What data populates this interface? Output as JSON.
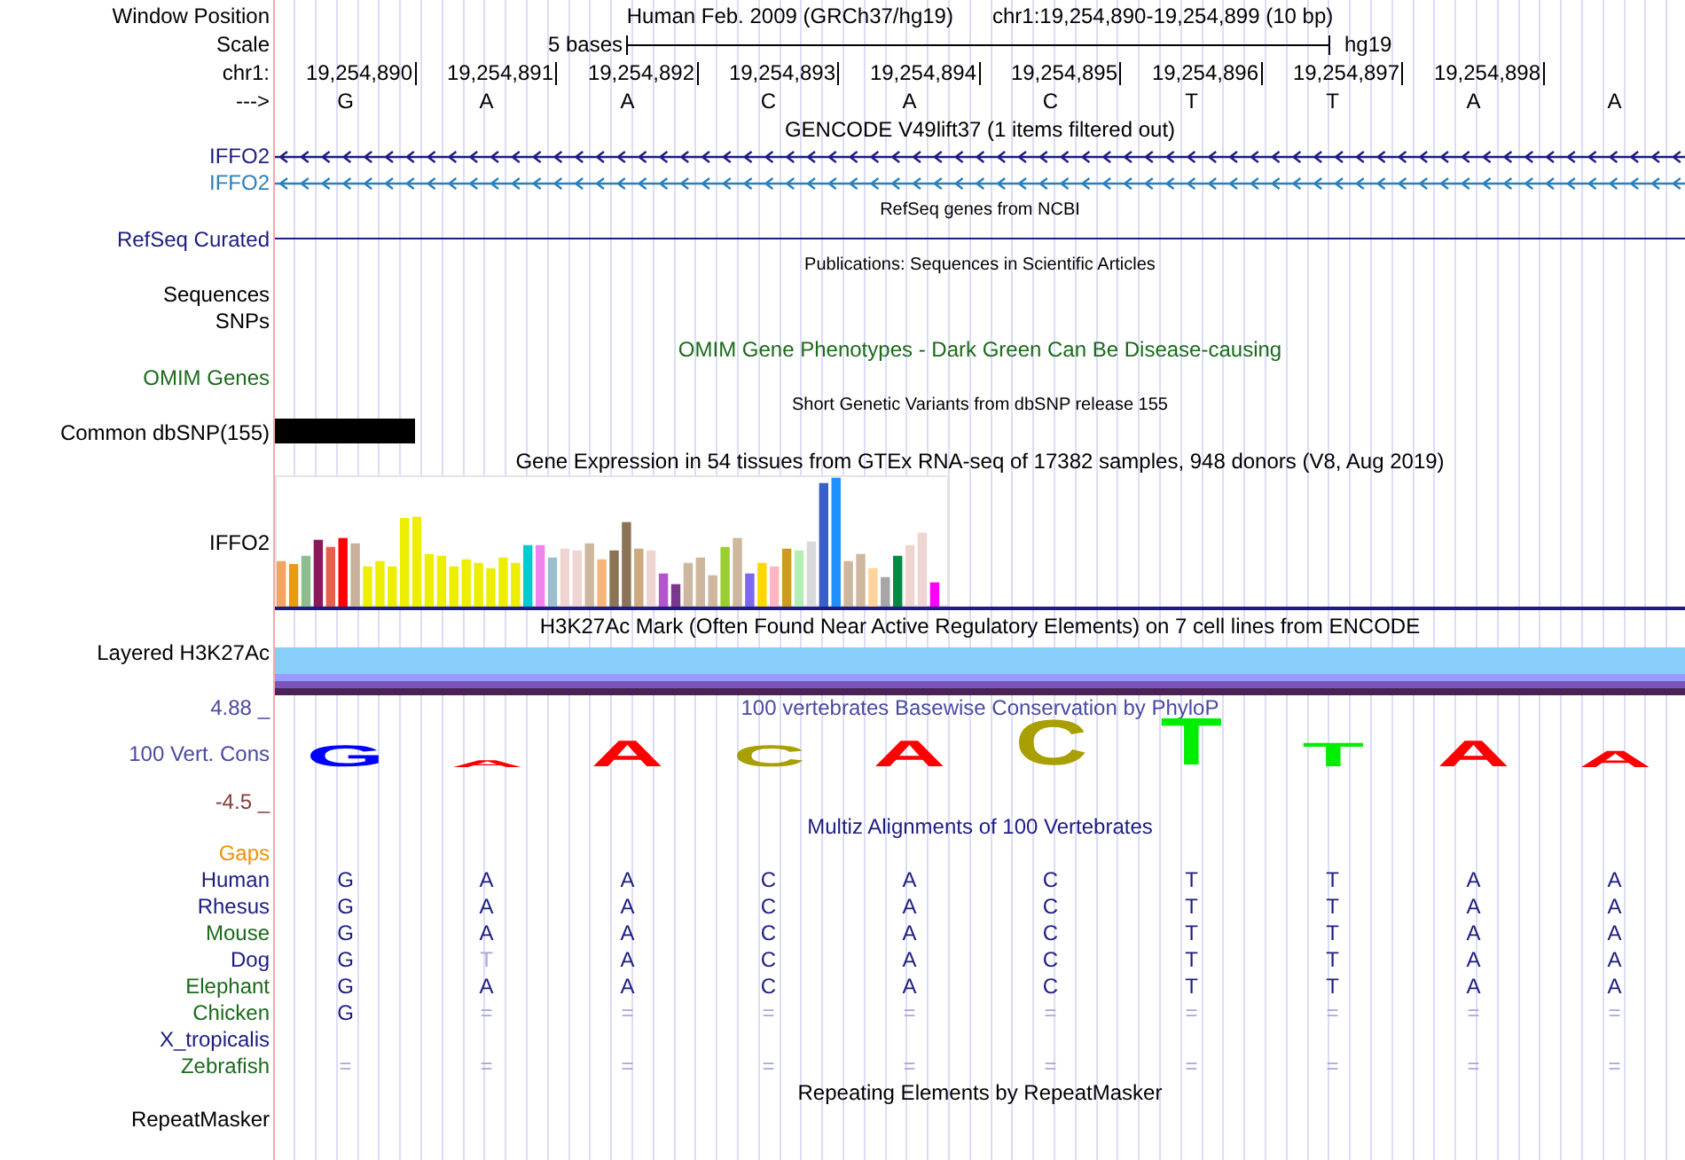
{
  "header": {
    "label": "Window Position",
    "assembly": "Human Feb. 2009 (GRCh37/hg19)",
    "position": "chr1:19,254,890-19,254,899 (10 bp)"
  },
  "scale": {
    "label": "Scale",
    "span": "5 bases",
    "assembly": "hg19"
  },
  "ruler": {
    "label": "chr1:",
    "positions": [
      "19,254,890",
      "19,254,891",
      "19,254,892",
      "19,254,893",
      "19,254,894",
      "19,254,895",
      "19,254,896",
      "19,254,897",
      "19,254,898"
    ]
  },
  "bases": {
    "label": "--->",
    "letters": [
      "G",
      "A",
      "A",
      "C",
      "A",
      "C",
      "T",
      "T",
      "A",
      "A"
    ]
  },
  "gencode": {
    "title": "GENCODE V49lift37 (1 items filtered out)",
    "transcripts": [
      {
        "name": "IFFO2",
        "color": "#1c1c84"
      },
      {
        "name": "IFFO2",
        "color": "#2a7fbd"
      }
    ]
  },
  "refseq": {
    "title": "RefSeq genes from NCBI",
    "label": "RefSeq Curated"
  },
  "publications": {
    "title": "Publications: Sequences in Scientific Articles",
    "labels": [
      "Sequences",
      "SNPs"
    ]
  },
  "omim": {
    "title": "OMIM Gene Phenotypes - Dark Green Can Be Disease-causing",
    "label": "OMIM Genes"
  },
  "dbsnp": {
    "title": "Short Genetic Variants from dbSNP release 155",
    "label": "Common dbSNP(155)"
  },
  "gtex": {
    "title": "Gene Expression in 54 tissues from GTEx RNA-seq of 17382 samples, 948 donors (V8, Aug 2019)",
    "label": "IFFO2"
  },
  "h3k27ac": {
    "title": "H3K27Ac Mark (Often Found Near Active Regulatory Elements) on 7 cell lines from ENCODE",
    "label": "Layered H3K27Ac"
  },
  "phylop": {
    "title": "100 vertebrates Basewise Conservation by PhyloP",
    "label": "100 Vert. Cons",
    "max": "4.88 _",
    "min": "-4.5 _",
    "letters": [
      {
        "base": "G",
        "color": "#0000ff"
      },
      {
        "base": "A",
        "color": "#ff0000"
      },
      {
        "base": "A",
        "color": "#ff0000"
      },
      {
        "base": "C",
        "color": "#a8a000"
      },
      {
        "base": "A",
        "color": "#ff0000"
      },
      {
        "base": "C",
        "color": "#a8a000"
      },
      {
        "base": "T",
        "color": "#00ee00"
      },
      {
        "base": "T",
        "color": "#00ee00"
      },
      {
        "base": "A",
        "color": "#ff0000"
      },
      {
        "base": "A",
        "color": "#ff0000"
      }
    ]
  },
  "multiz": {
    "title": "Multiz Alignments of 100 Vertebrates",
    "gaps_label": "Gaps",
    "species": [
      {
        "name": "Human",
        "color": "#1c1c84",
        "bases": [
          {
            "b": "G",
            "dim": false
          },
          {
            "b": "A",
            "dim": false
          },
          {
            "b": "A",
            "dim": false
          },
          {
            "b": "C",
            "dim": false
          },
          {
            "b": "A",
            "dim": false
          },
          {
            "b": "C",
            "dim": false
          },
          {
            "b": "T",
            "dim": false
          },
          {
            "b": "T",
            "dim": false
          },
          {
            "b": "A",
            "dim": false
          },
          {
            "b": "A",
            "dim": false
          }
        ]
      },
      {
        "name": "Rhesus",
        "color": "#1c1c84",
        "bases": [
          {
            "b": "G",
            "dim": false
          },
          {
            "b": "A",
            "dim": false
          },
          {
            "b": "A",
            "dim": false
          },
          {
            "b": "C",
            "dim": false
          },
          {
            "b": "A",
            "dim": false
          },
          {
            "b": "C",
            "dim": false
          },
          {
            "b": "T",
            "dim": false
          },
          {
            "b": "T",
            "dim": false
          },
          {
            "b": "A",
            "dim": false
          },
          {
            "b": "A",
            "dim": false
          }
        ]
      },
      {
        "name": "Mouse",
        "color": "#1a6b1a",
        "bases": [
          {
            "b": "G",
            "dim": false
          },
          {
            "b": "A",
            "dim": false
          },
          {
            "b": "A",
            "dim": false
          },
          {
            "b": "C",
            "dim": false
          },
          {
            "b": "A",
            "dim": false
          },
          {
            "b": "C",
            "dim": false
          },
          {
            "b": "T",
            "dim": false
          },
          {
            "b": "T",
            "dim": false
          },
          {
            "b": "A",
            "dim": false
          },
          {
            "b": "A",
            "dim": false
          }
        ]
      },
      {
        "name": "Dog",
        "color": "#1c1c84",
        "bases": [
          {
            "b": "G",
            "dim": false
          },
          {
            "b": "T",
            "dim": true
          },
          {
            "b": "A",
            "dim": false
          },
          {
            "b": "C",
            "dim": false
          },
          {
            "b": "A",
            "dim": false
          },
          {
            "b": "C",
            "dim": false
          },
          {
            "b": "T",
            "dim": false
          },
          {
            "b": "T",
            "dim": false
          },
          {
            "b": "A",
            "dim": false
          },
          {
            "b": "A",
            "dim": false
          }
        ]
      },
      {
        "name": "Elephant",
        "color": "#1a6b1a",
        "bases": [
          {
            "b": "G",
            "dim": false
          },
          {
            "b": "A",
            "dim": false
          },
          {
            "b": "A",
            "dim": false
          },
          {
            "b": "C",
            "dim": false
          },
          {
            "b": "A",
            "dim": false
          },
          {
            "b": "C",
            "dim": false
          },
          {
            "b": "T",
            "dim": false
          },
          {
            "b": "T",
            "dim": false
          },
          {
            "b": "A",
            "dim": false
          },
          {
            "b": "A",
            "dim": false
          }
        ]
      },
      {
        "name": "Chicken",
        "color": "#1a6b1a",
        "bases": [
          {
            "b": "G",
            "dim": false
          },
          {
            "b": "=",
            "dim": true
          },
          {
            "b": "=",
            "dim": true
          },
          {
            "b": "=",
            "dim": true
          },
          {
            "b": "=",
            "dim": true
          },
          {
            "b": "=",
            "dim": true
          },
          {
            "b": "=",
            "dim": true
          },
          {
            "b": "=",
            "dim": true
          },
          {
            "b": "=",
            "dim": true
          },
          {
            "b": "=",
            "dim": true
          }
        ]
      },
      {
        "name": "X_tropicalis",
        "color": "#1c1c84"
      },
      {
        "name": "Zebrafish",
        "color": "#1a6b1a",
        "bases": [
          {
            "b": "=",
            "dim": true
          },
          {
            "b": "=",
            "dim": true
          },
          {
            "b": "=",
            "dim": true
          },
          {
            "b": "=",
            "dim": true
          },
          {
            "b": "=",
            "dim": true
          },
          {
            "b": "=",
            "dim": true
          },
          {
            "b": "=",
            "dim": true
          },
          {
            "b": "=",
            "dim": true
          },
          {
            "b": "=",
            "dim": true
          },
          {
            "b": "=",
            "dim": true
          }
        ]
      }
    ]
  },
  "repeatmasker": {
    "title": "Repeating Elements by RepeatMasker",
    "label": "RepeatMasker"
  }
}
